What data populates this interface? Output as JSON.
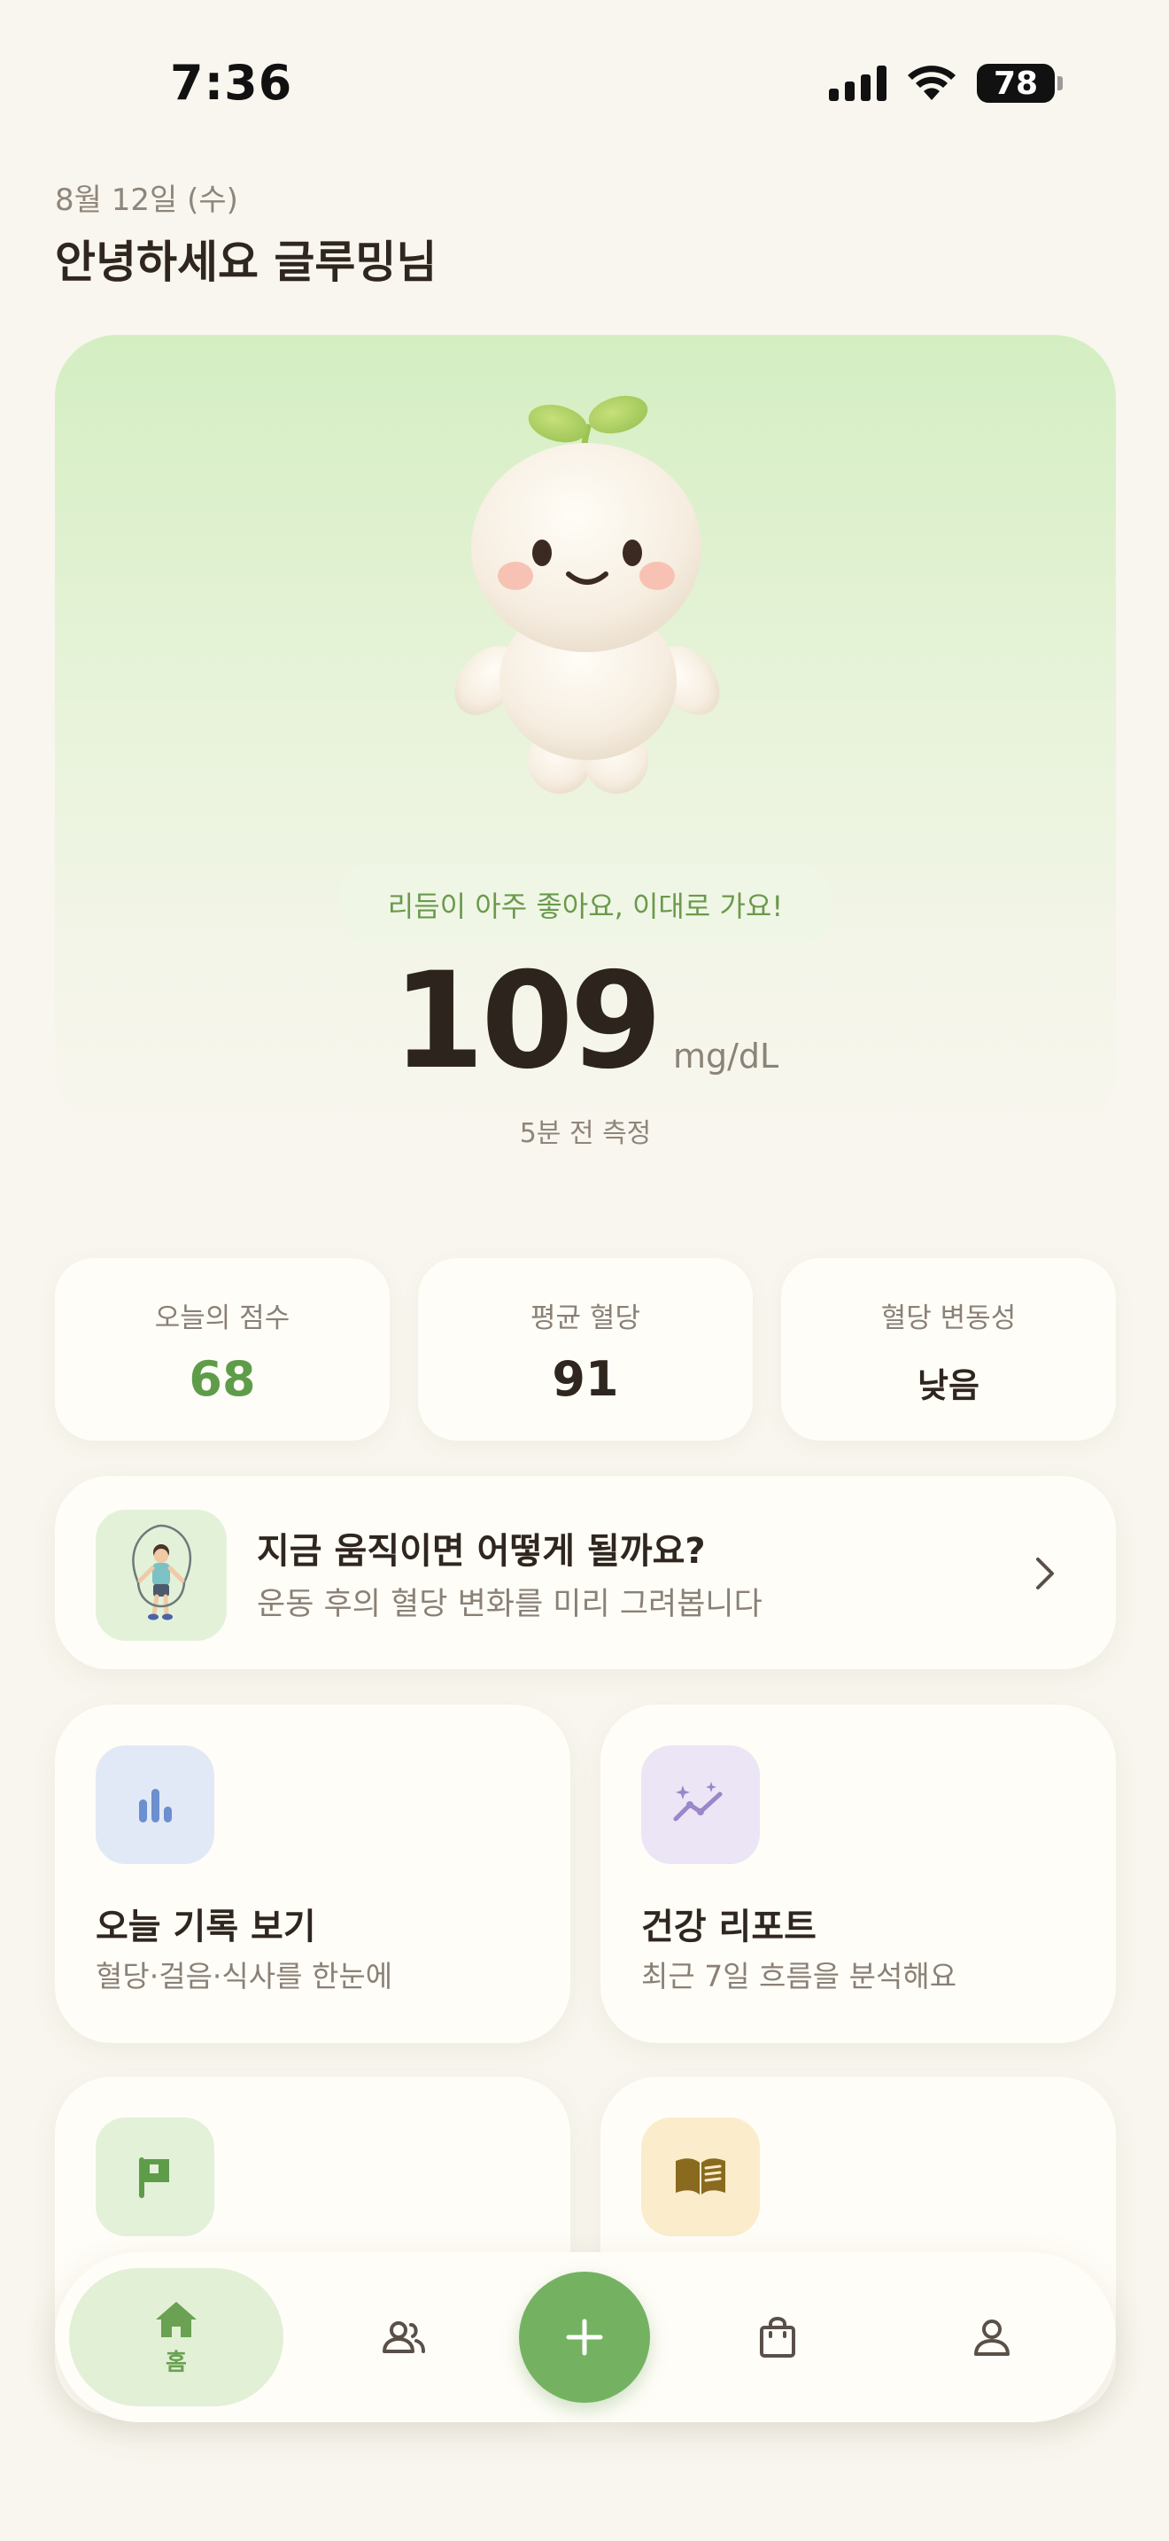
{
  "status_bar": {
    "time": "7:36",
    "battery": "78"
  },
  "header": {
    "date": "8월 12일 (수)",
    "greeting": "안녕하세요 글루밍님"
  },
  "hero": {
    "message": "리듬이 아주 좋아요, 이대로 가요!",
    "glucose_value": "109",
    "glucose_unit": "mg/dL",
    "measured": "5분 전 측정"
  },
  "stats": [
    {
      "label": "오늘의 점수",
      "value": "68"
    },
    {
      "label": "평균 혈당",
      "value": "91"
    },
    {
      "label": "혈당 변동성",
      "value": "낮음"
    }
  ],
  "banner": {
    "title": "지금 움직이면 어떻게 될까요?",
    "subtitle": "운동 후의 혈당 변화를 미리 그려봅니다"
  },
  "features": [
    {
      "title": "오늘 기록 보기",
      "subtitle": "혈당·걸음·식사를 한눈에",
      "icon": "bar-chart-icon",
      "color": "#e2e9f6"
    },
    {
      "title": "건강 리포트",
      "subtitle": "최근 7일 흐름을 분석해요",
      "icon": "trend-sparkle-icon",
      "color": "#ebe5f6"
    },
    {
      "icon": "flag-icon",
      "color": "#e3f1d9"
    },
    {
      "icon": "book-icon",
      "color": "#fbeccb"
    }
  ],
  "nav": {
    "home_label": "홈"
  },
  "colors": {
    "accent": "#74b262",
    "score": "#5f9c4a"
  }
}
